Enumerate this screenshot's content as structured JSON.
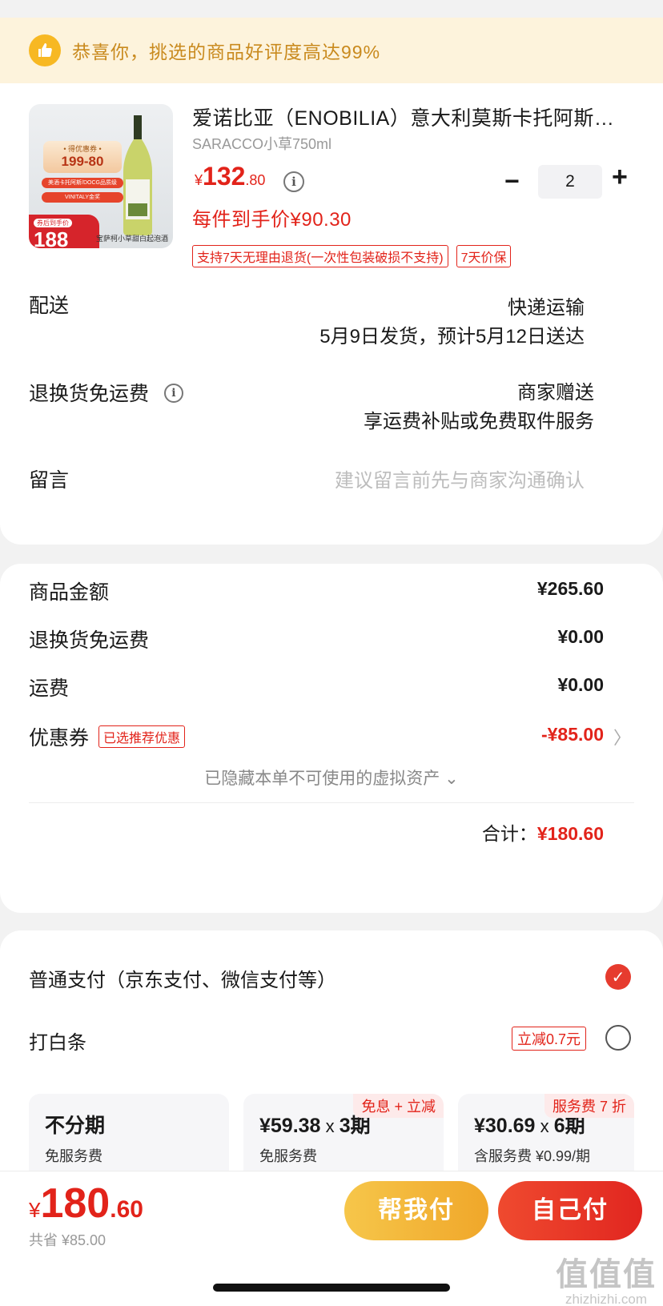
{
  "banner": {
    "text": "恭喜你，挑选的商品好评度高达99%",
    "icon": "thumbs-up-icon"
  },
  "product": {
    "title": "爱诺比亚（ENOBILIA）意大利莫斯卡托阿斯蒂起泡酒",
    "spec": "SARACCO小草750ml",
    "price_currency": "¥",
    "price_int": "132",
    "price_dec": ".80",
    "quantity": "2",
    "unit_price": "每件到手价¥90.30",
    "tags": [
      "支持7天无理由退货(一次性包装破损不支持)",
      "7天价保"
    ],
    "image": {
      "promo_top": "• 得优惠券 •",
      "promo_main": "199-80",
      "ribbon1": "美酒卡托阿斯/DOCG品质级",
      "ribbon2": "VINITALY金奖",
      "badge_small": "券后到手价",
      "badge_num": "188",
      "name": "宝萨柯小草甜白起泡酒"
    }
  },
  "shipping": {
    "label": "配送",
    "method": "快递运输",
    "eta": "5月9日发货，预计5月12日送达"
  },
  "return_ship": {
    "label": "退换货免运费",
    "value1": "商家赠送",
    "value2": "享运费补贴或免费取件服务"
  },
  "message": {
    "label": "留言",
    "placeholder": "建议留言前先与商家沟通确认"
  },
  "fees": {
    "goods_label": "商品金额",
    "goods_value": "¥265.60",
    "return_label": "退换货免运费",
    "return_value": "¥0.00",
    "freight_label": "运费",
    "freight_value": "¥0.00",
    "coupon_label": "优惠券",
    "coupon_tag": "已选推荐优惠",
    "coupon_value": "-¥85.00",
    "hidden_assets": "已隐藏本单不可使用的虚拟资产 ⌄",
    "total_label": "合计：",
    "total_value": "¥180.60"
  },
  "payment": {
    "normal_label": "普通支付（京东支付、微信支付等）",
    "baitiao_label": "打白条",
    "baitiao_tag": "立减0.7元",
    "plans": [
      {
        "main": "不分期",
        "sub": "免服务费",
        "tag": ""
      },
      {
        "main_amount": "¥59.38",
        "main_x": " x ",
        "main_period": "3期",
        "sub": "免服务费",
        "tag": "免息 + 立减"
      },
      {
        "main_amount": "¥30.69",
        "main_x": " x ",
        "main_period": "6期",
        "sub": "含服务费 ¥0.99/期",
        "tag": "服务费 7 折"
      }
    ]
  },
  "footer": {
    "price_currency": "¥",
    "price_int": "180",
    "price_dec": ".60",
    "saved": "共省 ¥85.00",
    "help_pay": "帮我付",
    "self_pay": "自己付",
    "watermark_big": "值值值",
    "watermark_small": "zhizhizhi.com"
  },
  "colors": {
    "accent": "#e2231a",
    "banner_bg": "#fdf3dc",
    "banner_text": "#c98a1e",
    "help_btn": "#f0a72a"
  }
}
